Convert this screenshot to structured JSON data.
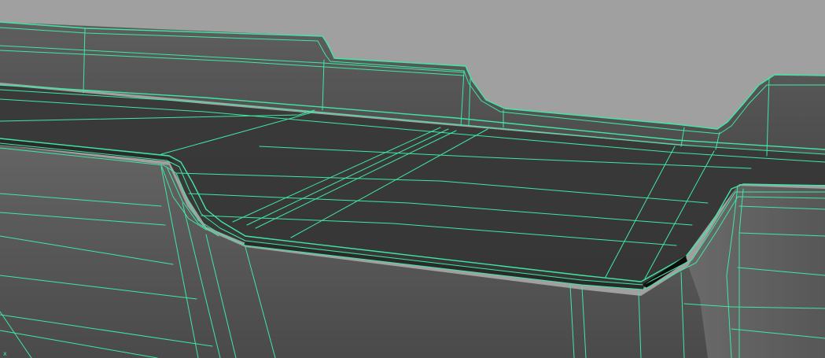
{
  "viewport": {
    "background_color": "#a0a0a0",
    "wire_color": "#3ee8a4",
    "surface_colors": {
      "top_face": "#3a3a3a",
      "top_face_far": "#333333",
      "front_face": "#5c5c5c",
      "front_face_dark": "#4a4a4a",
      "back_wall": "#565656",
      "bevel": "#4e4e4e"
    },
    "axis_label": "x"
  }
}
